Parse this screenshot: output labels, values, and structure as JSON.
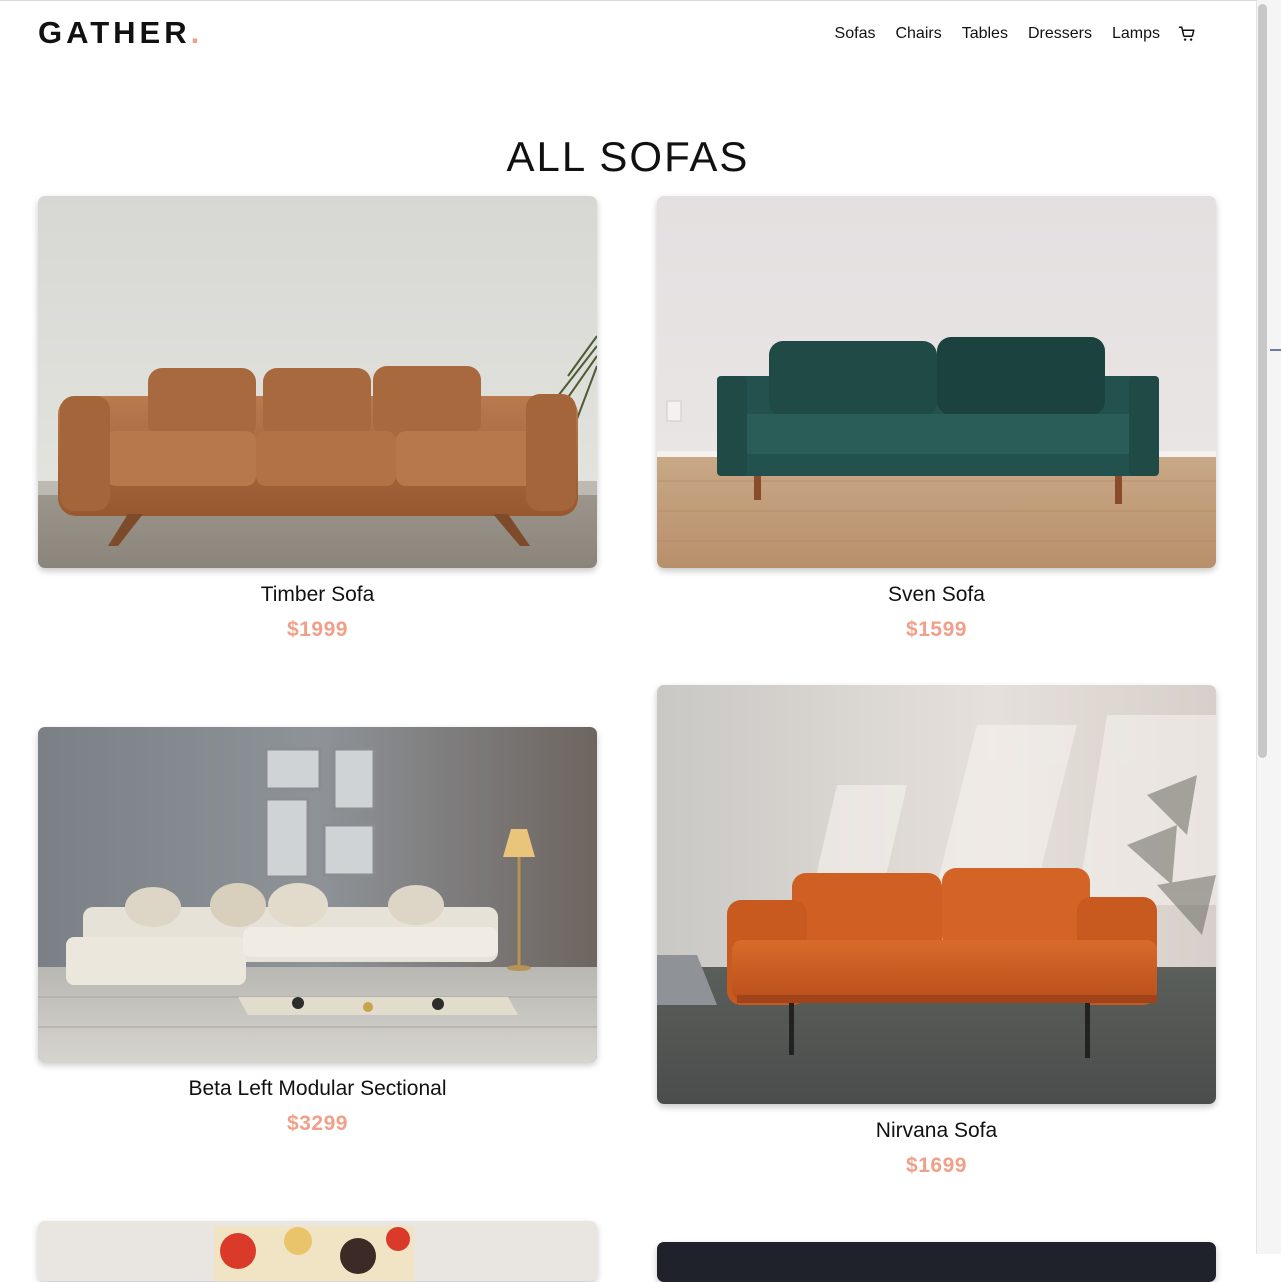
{
  "brand": {
    "name": "GATHER",
    "dot": ".",
    "accent": "#f0a089"
  },
  "nav": {
    "items": [
      {
        "label": "Sofas"
      },
      {
        "label": "Chairs"
      },
      {
        "label": "Tables"
      },
      {
        "label": "Dressers"
      },
      {
        "label": "Lamps"
      }
    ],
    "cart_icon": "cart-icon"
  },
  "page": {
    "title": "ALL SOFAS"
  },
  "products": [
    {
      "name": "Timber Sofa",
      "price": "$1999",
      "image": "tan-leather-sofa-photo"
    },
    {
      "name": "Sven Sofa",
      "price": "$1599",
      "image": "green-velvet-sofa-photo"
    },
    {
      "name": "Beta Left Modular Sectional",
      "price": "$3299",
      "image": "white-sectional-photo"
    },
    {
      "name": "Nirvana Sofa",
      "price": "$1699",
      "image": "orange-leather-sofa-photo"
    }
  ]
}
